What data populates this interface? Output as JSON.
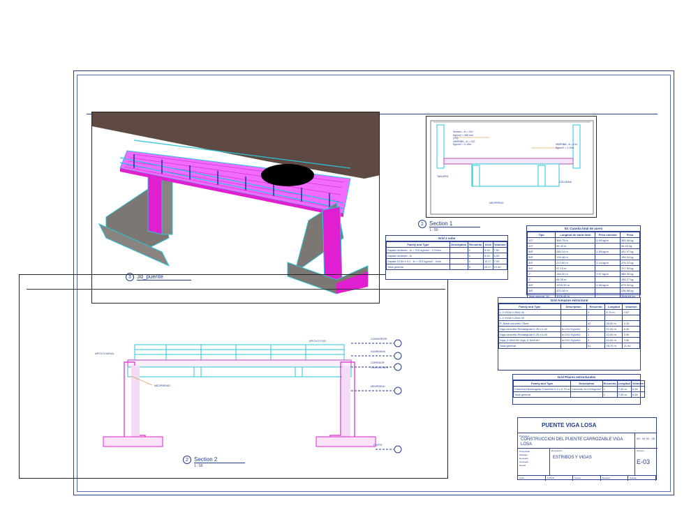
{
  "views": {
    "view_3d": {
      "number": "3",
      "title": "3d_puente",
      "scale": ""
    },
    "section1": {
      "number": "1",
      "title": "Section 1",
      "scale": "1 : 50",
      "labels": [
        "Mortero - fc = 210",
        "Kg/cm2 = 280 mm",
        "(1:5)",
        "VARRIBA - fc = 210",
        "Kg/cm2 = 2.10m",
        "VARRIBA - fc = 210",
        "Kg/cm2 = 2.10m",
        "TABLERO",
        "COLUMNA",
        "NEOPRENO"
      ]
    },
    "section2": {
      "number": "2",
      "title": "Section 2",
      "scale": "1 : 50",
      "labels": {
        "apoyo_movil": "APOYO MOVIL",
        "apoyo_fijo": "APOYO FIJO",
        "neopreno": "NEOPRENO",
        "corte": "CORTE",
        "right_levels": [
          "CONVIERNTE",
          "GUARDAVIA",
          "CORRIDOR",
          "DIMENSIONES",
          "NEOPRENO"
        ]
      }
    }
  },
  "schedules": {
    "fundations": {
      "title": "Grid 2 sobs",
      "headers": [
        "Family and Type",
        "Description",
        "Recuento",
        "Area",
        "Volumen"
      ],
      "rows": [
        [
          "Zapata cimiento - fc = 210 kg/cm2 - 2.00mx - ...",
          "",
          "1",
          "5.00",
          "7.50"
        ],
        [
          "Zapata cimiento - fc",
          "",
          "1",
          "5.00",
          "5.00"
        ],
        [
          "Zapata 10.50 x 3.1 - fc = 210 kg/cm2 - 2x4x",
          "",
          "1",
          "13.17",
          "7.00"
        ],
        [
          "Total general",
          "",
          "3",
          "23.17",
          "19.50"
        ]
      ]
    },
    "rebar": {
      "title": "03. Cuantia total de acero",
      "headers": [
        "Tipo",
        "Longitud de barra total",
        "Peso nominal",
        "Peso"
      ],
      "rows": [
        [
          "1/2\"",
          "368.75 m",
          "0.99 kg/m",
          "365.06 kg"
        ],
        [
          "1/2\"",
          "95.40 m",
          "",
          "94.45 kg"
        ],
        [
          "5/8\"",
          "285.14 m",
          "1.55 kg/m",
          "441.97 kg"
        ],
        [
          "5/8\"",
          "126.48 m",
          "",
          "196.04 kg"
        ],
        [
          "3/4\"",
          "212.60 m",
          "2.24 kg/m",
          "476.22 kg"
        ],
        [
          "3/4\"",
          "97.10 m",
          "",
          "217.50 kg"
        ],
        [
          "1\"",
          "148.20 m",
          "3.97 kg/m",
          "588.35 kg"
        ],
        [
          "1\"",
          "64.30 m",
          "",
          "255.27 kg"
        ],
        [
          "3/8\"",
          "1205.33 m",
          "0.56 kg/m",
          "675.00 kg"
        ],
        [
          "3/8\"",
          "423.18 m",
          "",
          "236.98 kg"
        ],
        [
          "Total general: 16",
          "3026.48 m",
          "",
          "3546.84 kg"
        ]
      ]
    },
    "structural_framing": {
      "title": "Grid Armazon estructural",
      "headers": [
        "Family and Type",
        "Description",
        "Recuento",
        "Longitud",
        "Volumen"
      ],
      "rows": [
        [
          "L-3 VIGA 0.25x0.40",
          "",
          "2",
          "8.70 m",
          "0.87"
        ],
        [
          "L-3 VIGA 0.25x0.40",
          "",
          "",
          "",
          ""
        ],
        [
          "P_Base concreto 75cm",
          "",
          "42",
          "28.00 m",
          "5.15"
        ],
        [
          "Viga concreto Rectangular 0.25 x 0.40",
          "fc=210 Kg/cm2",
          "4",
          "22.00 m",
          "8.40"
        ],
        [
          "Viga concreto Rectangular 0.25 x 0.40",
          "fc=210 Kg/cm2",
          "1",
          "10.00 m",
          "3.90"
        ],
        [
          "Viga_0.30x0.60 Viga_0.30x0.60",
          "fc=210 Kg/cm2",
          "2",
          "10.00 m",
          "3.60"
        ],
        [
          "Total general",
          "",
          "51",
          "78.70 m",
          "21.92"
        ]
      ]
    },
    "structural_columns": {
      "title": "Grid Pilares estructurales",
      "headers": [
        "Family and Type",
        "Description",
        "Recuento",
        "Longitud",
        "Volumen"
      ],
      "rows": [
        [
          "Columna Rectangular Concreto 0.4 x 0.75 m",
          "Concreto fc=210kg/cm2",
          "2",
          "7.30 m",
          "6.63"
        ],
        [
          "Total general",
          "",
          "2",
          "7.30 m",
          "6.63"
        ]
      ]
    }
  },
  "title_block": {
    "project_name": "PUENTE VIGA LOSA",
    "owner_label": "Propietario",
    "owner_value": "CONSTRUCCION DEL PUENTE CARROZABLE VIGA LOSA",
    "date_value": "03 - 04\n02 - 05",
    "names": [
      "Proyectado",
      "Dibujado",
      "Revisado",
      "Aprobado",
      "Escala"
    ],
    "description_label": "Descripción",
    "description_value": "ESTRIBOS Y VIGAS",
    "sheet_label": "Número",
    "sheet_number": "E-03",
    "footer": [
      "Autor",
      "AUTOR",
      "Fecha",
      "Revisión",
      "Escala"
    ]
  },
  "colors": {
    "border": "#2b3f91",
    "magenta": "#e020d0",
    "cyan": "#29c5d9",
    "concrete": "#7d7773",
    "ground": "#5e4a42"
  }
}
